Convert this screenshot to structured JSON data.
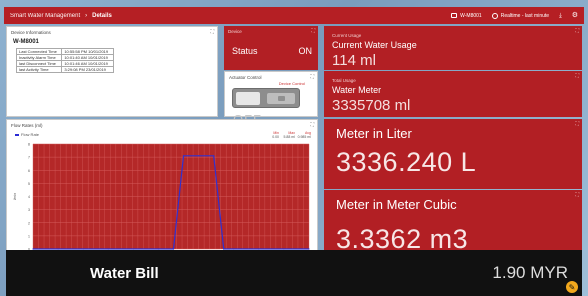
{
  "header": {
    "app_title": "Smart Water Management",
    "separator": "›",
    "current_page": "Details",
    "device_label": "W-M8001",
    "time_range": "Realtime - last minute"
  },
  "device_info": {
    "title": "Device Informations",
    "device_id": "W-M8001",
    "rows": [
      {
        "label": "Last Connected Time",
        "value": "10:55:58 PM 10/01/2019"
      },
      {
        "label": "Inactivity Alarm Time",
        "value": "10:01:40 AM 10/01/2019"
      },
      {
        "label": "last Disconnect Time",
        "value": "10:01:46 AM 10/01/2019"
      },
      {
        "label": "last Activity Time",
        "value": "3:29:08 PM 23/01/2019"
      }
    ]
  },
  "device_status": {
    "title": "Device",
    "label": "Status",
    "value": "ON"
  },
  "actuator": {
    "title": "Actuator Control",
    "subtitle": "Device Control",
    "state": "OFF"
  },
  "current_usage": {
    "sub": "Current Usage",
    "title": "Current Water Usage",
    "value": "114 ml"
  },
  "total_usage": {
    "sub": "Total Usage",
    "title": "Water Meter",
    "value": "3335708 ml"
  },
  "meter_liter": {
    "label": "Meter in Liter",
    "value": "3336.240 L"
  },
  "meter_cubic": {
    "label": "Meter in Meter Cubic",
    "value": "3.3362 m3"
  },
  "bill": {
    "label": "Water Bill",
    "value": "1.90 MYR"
  },
  "colors": {
    "accent_red": "#b21f24",
    "chart_bg": "#b42828",
    "line": "#3030d0"
  },
  "chart_data": {
    "type": "line",
    "title": "Flow Rates (ml)",
    "legend": [
      "Flow Rate"
    ],
    "stats_headers": [
      "Min",
      "Max",
      "Avg"
    ],
    "stats_values": [
      "0.00",
      "5.88 ml",
      "0.985 ml"
    ],
    "xlabel": "time in seconds",
    "ylabel": "l/min",
    "ylim": [
      0,
      8
    ],
    "y_ticks": [
      "0",
      "1",
      "2",
      "3",
      "4",
      "5",
      "6",
      "7",
      "8"
    ],
    "x_ticks": [
      "10:48:00",
      "10:48:05",
      "10:48:10",
      "10:48:15",
      "10:48:20",
      "10:48:25",
      "10:48:30",
      "10:48:35",
      "10:48:40",
      "10:48:45",
      "10:48:50",
      "10:48:55"
    ],
    "series": [
      {
        "name": "Flow Rate",
        "x": [
          0,
          5,
          10,
          15,
          20,
          25,
          28,
          30,
          33,
          36,
          38,
          40,
          45,
          50,
          55
        ],
        "values": [
          0,
          0,
          0,
          0,
          0,
          0,
          0,
          7.1,
          7.1,
          7.1,
          0,
          0,
          0,
          0,
          0
        ]
      }
    ]
  }
}
